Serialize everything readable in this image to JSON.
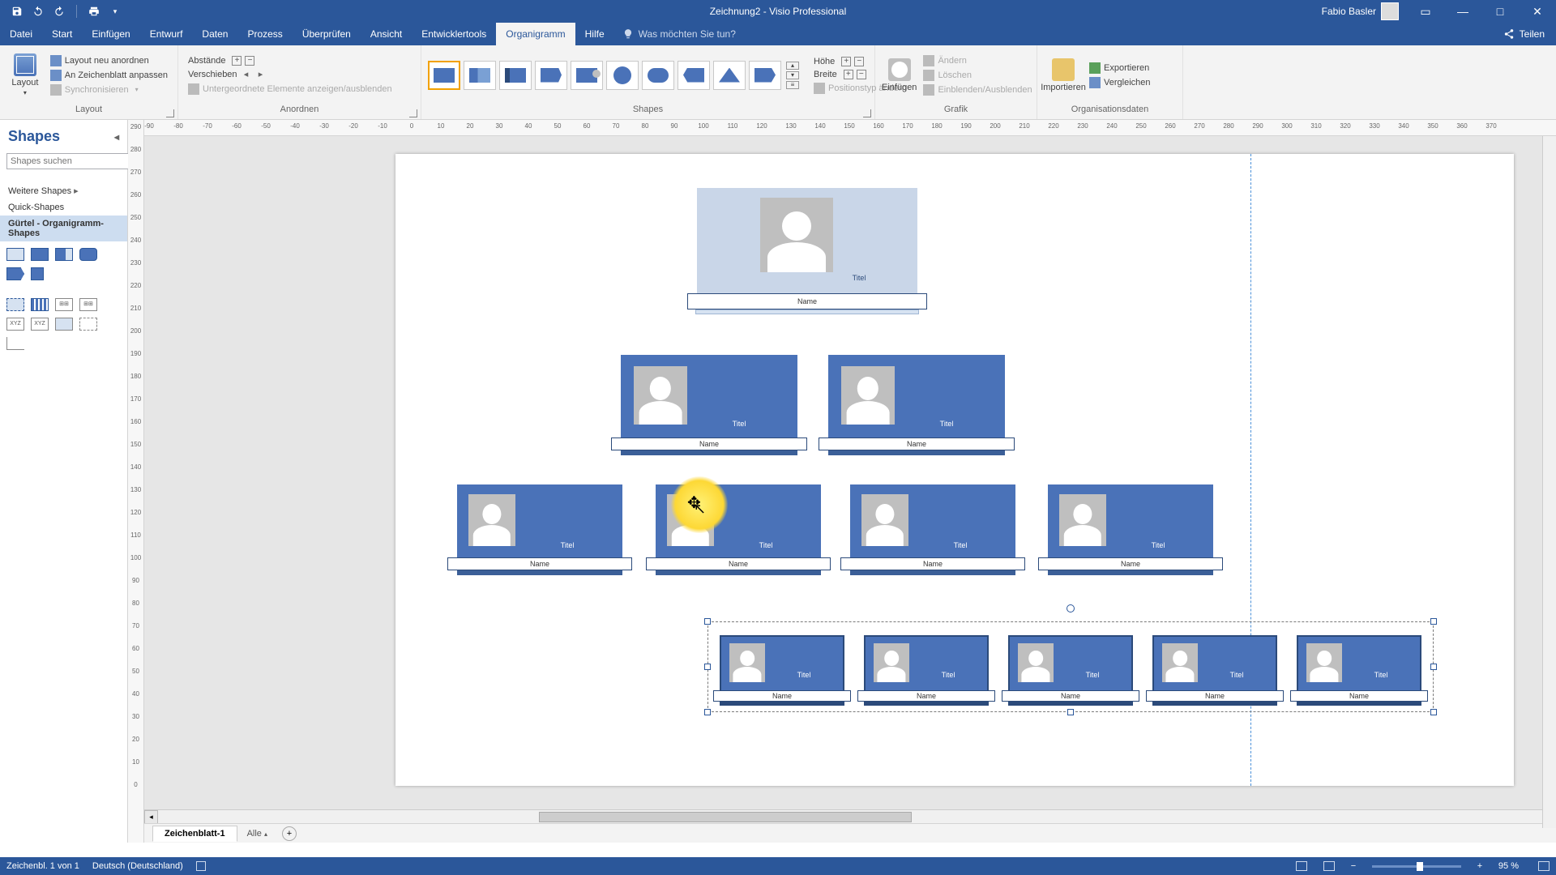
{
  "app": {
    "title": "Zeichnung2 - Visio Professional",
    "user": "Fabio Basler"
  },
  "tabs": {
    "items": [
      "Datei",
      "Start",
      "Einfügen",
      "Entwurf",
      "Daten",
      "Prozess",
      "Überprüfen",
      "Ansicht",
      "Entwicklertools",
      "Organigramm",
      "Hilfe"
    ],
    "active_index": 9,
    "tell_me": "Was möchten Sie tun?",
    "share": "Teilen"
  },
  "ribbon": {
    "layout": {
      "big": "Layout",
      "items": [
        "Layout neu anordnen",
        "An Zeichenblatt anpassen",
        "Synchronisieren"
      ],
      "group_label": "Layout"
    },
    "anordnen": {
      "row1": "Abstände",
      "row2": "Verschieben",
      "row3": "Untergeordnete Elemente anzeigen/ausblenden",
      "group_label": "Anordnen"
    },
    "shapes": {
      "group_label": "Shapes"
    },
    "size": {
      "hoehe": "Höhe",
      "breite": "Breite",
      "pos": "Positionstyp ändern"
    },
    "bild": {
      "big": "Einfügen",
      "items": [
        "Ändern",
        "Löschen",
        "Einblenden/Ausblenden"
      ],
      "group_label": "Grafik"
    },
    "orgdata": {
      "import": "Importieren",
      "export": "Exportieren",
      "compare": "Vergleichen",
      "group_label": "Organisationsdaten"
    }
  },
  "shapes_pane": {
    "title": "Shapes",
    "search_placeholder": "Shapes suchen",
    "categories": [
      "Weitere Shapes",
      "Quick-Shapes",
      "Gürtel - Organigramm-Shapes"
    ],
    "active_index": 2
  },
  "h_ruler_ticks": [
    "-90",
    "-80",
    "-70",
    "-60",
    "-50",
    "-40",
    "-30",
    "-20",
    "-10",
    "0",
    "10",
    "20",
    "30",
    "40",
    "50",
    "60",
    "70",
    "80",
    "90",
    "100",
    "110",
    "120",
    "130",
    "140",
    "150",
    "160",
    "170",
    "180",
    "190",
    "200",
    "210",
    "220",
    "230",
    "240",
    "250",
    "260",
    "270",
    "280",
    "290",
    "300",
    "310",
    "320",
    "330",
    "340",
    "350",
    "360",
    "370"
  ],
  "v_ruler_ticks": [
    "290",
    "280",
    "270",
    "260",
    "250",
    "240",
    "230",
    "220",
    "210",
    "200",
    "190",
    "180",
    "170",
    "160",
    "150",
    "140",
    "130",
    "120",
    "110",
    "100",
    "90",
    "80",
    "70",
    "60",
    "50",
    "40",
    "30",
    "20",
    "10",
    "0"
  ],
  "card_labels": {
    "title": "Titel",
    "name": "Name"
  },
  "sheet_tabs": {
    "active": "Zeichenblatt-1",
    "all": "Alle"
  },
  "status": {
    "left1": "Zeichenbl. 1 von 1",
    "left2": "Deutsch (Deutschland)",
    "zoom": "95 %"
  }
}
